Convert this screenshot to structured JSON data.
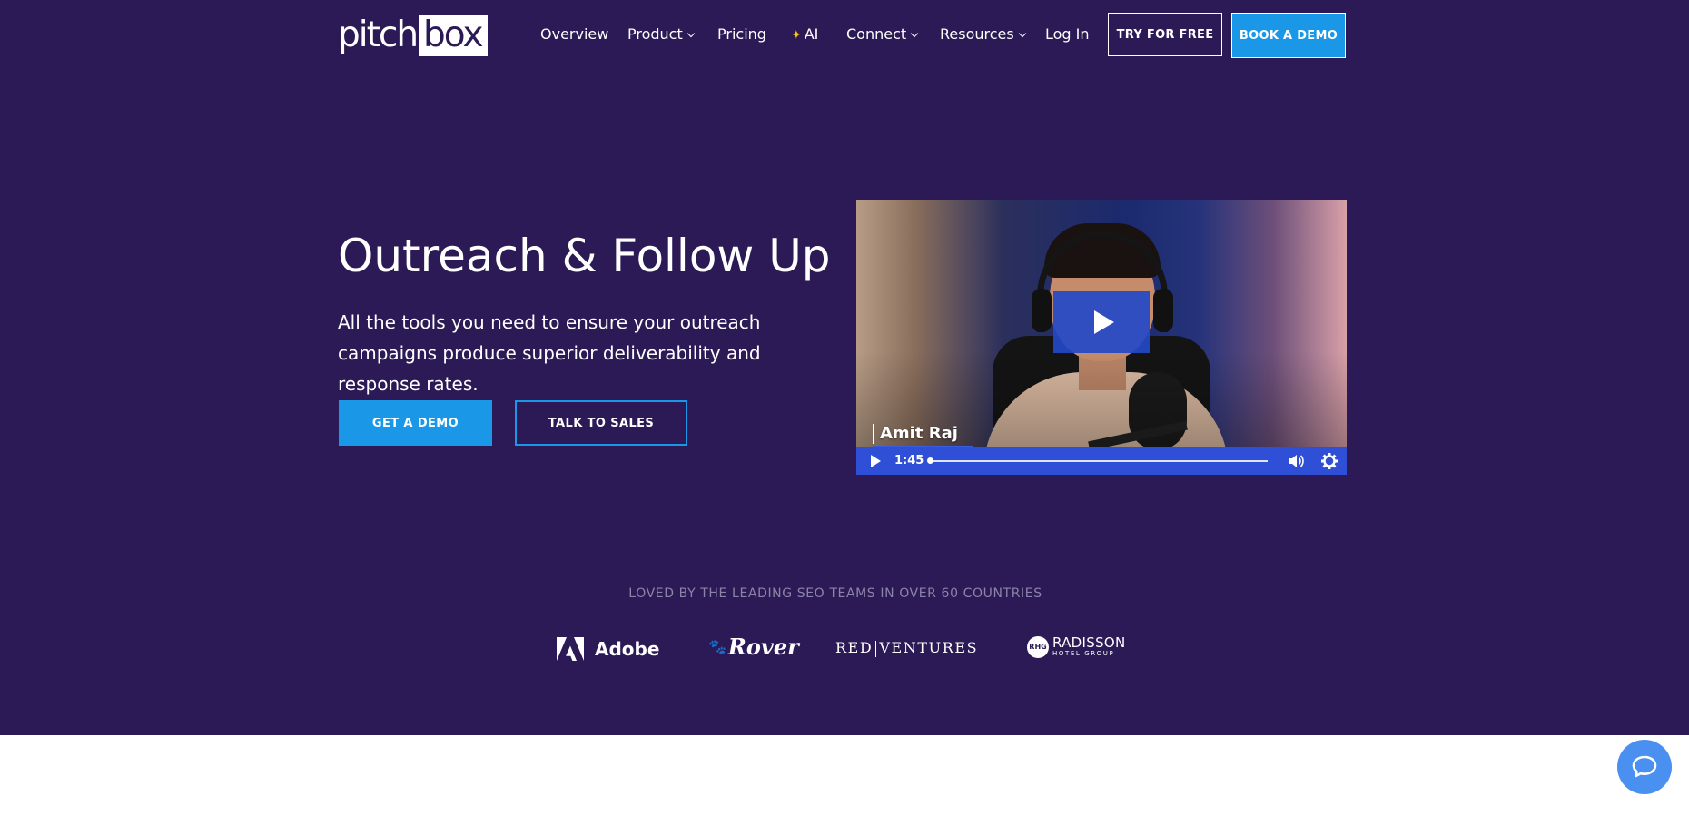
{
  "header": {
    "logo_part1": "pitch",
    "logo_part2": "box",
    "nav": [
      {
        "label": "Overview"
      },
      {
        "label": "Product"
      },
      {
        "label": "Pricing"
      },
      {
        "label": "AI",
        "icon": "sparkle-icon"
      },
      {
        "label": "Connect"
      },
      {
        "label": "Resources"
      },
      {
        "label": "Log In"
      }
    ],
    "try_free": "TRY FOR FREE",
    "book_demo": "BOOK A DEMO"
  },
  "hero": {
    "title": "Outreach & Follow Up",
    "subtitle": "All the tools you need to ensure your outreach campaigns produce superior deliverability and response rates.",
    "cta_primary": "GET A DEMO",
    "cta_secondary": "TALK TO SALES"
  },
  "video": {
    "speaker_name": "Amit Raj",
    "duration": "1:45",
    "progress": 0
  },
  "social_proof": {
    "heading": "LOVED BY THE LEADING SEO TEAMS IN OVER 60 COUNTRIES",
    "logos": {
      "adobe": "Adobe",
      "rover": "Rover",
      "red_ventures_a": "RED",
      "red_ventures_b": "VENTURES",
      "radisson_mark": "RHG",
      "radisson_name": "RADISSON",
      "radisson_sub": "HOTEL GROUP"
    }
  },
  "colors": {
    "hero_bg": "#2b1a55",
    "accent_blue": "#1a97e6",
    "video_controls": "#2e4fd6",
    "chat_bubble": "#4a90f0"
  }
}
